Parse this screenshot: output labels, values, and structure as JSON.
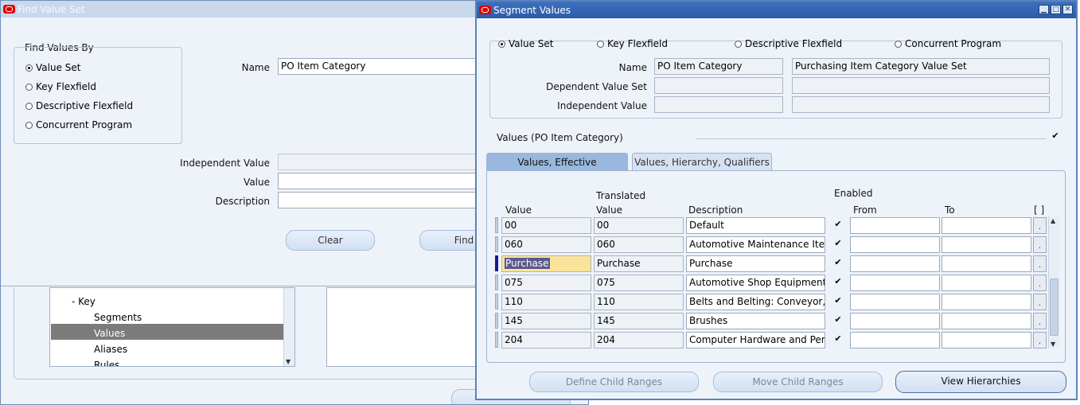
{
  "find_window": {
    "title": "Find Value Set",
    "group_label": "Find Values By",
    "options": [
      "Value Set",
      "Key Flexfield",
      "Descriptive Flexfield",
      "Concurrent Program"
    ],
    "selected_option": "Value Set",
    "name_label": "Name",
    "name_value": "PO Item Category",
    "independent_value_label": "Independent Value",
    "value_label": "Value",
    "description_label": "Description",
    "clear_button": "Clear",
    "find_button": "Find",
    "tree_items": [
      {
        "label": "-  Key",
        "selected": false
      },
      {
        "label": "Segments",
        "selected": false
      },
      {
        "label": "Values",
        "selected": true
      },
      {
        "label": "Aliases",
        "selected": false
      },
      {
        "label": "Rules",
        "selected": false
      }
    ]
  },
  "segment_window": {
    "title": "Segment Values",
    "options": [
      "Value Set",
      "Key Flexfield",
      "Descriptive Flexfield",
      "Concurrent Program"
    ],
    "selected_option": "Value Set",
    "name_label": "Name",
    "name_value": "PO Item Category",
    "name_description": "Purchasing Item Category Value Set",
    "dependent_value_set_label": "Dependent Value Set",
    "independent_value_label": "Independent Value",
    "values_section_label": "Values (PO Item Category)",
    "tabs": [
      "Values, Effective",
      "Values, Hierarchy, Qualifiers"
    ],
    "active_tab": "Values, Effective",
    "columns": {
      "value": "Value",
      "translated_top": "Translated",
      "translated_bottom": "Value",
      "description": "Description",
      "enabled": "Enabled",
      "from": "From",
      "to": "To",
      "flex": "[ ]"
    },
    "rows": [
      {
        "value": "00",
        "translated": "00",
        "description": "Default",
        "enabled": true,
        "current": false
      },
      {
        "value": "060",
        "translated": "060",
        "description": "Automotive Maintenance Item",
        "enabled": true,
        "current": false
      },
      {
        "value": "Purchase",
        "translated": "Purchase",
        "description": "Purchase",
        "enabled": true,
        "current": true
      },
      {
        "value": "075",
        "translated": "075",
        "description": "Automotive Shop Equipment a",
        "enabled": true,
        "current": false
      },
      {
        "value": "110",
        "translated": "110",
        "description": "Belts and Belting: Conveyor, E",
        "enabled": true,
        "current": false
      },
      {
        "value": "145",
        "translated": "145",
        "description": "Brushes",
        "enabled": true,
        "current": false
      },
      {
        "value": "204",
        "translated": "204",
        "description": "Computer Hardware and Perip",
        "enabled": true,
        "current": false
      }
    ],
    "buttons": {
      "define_child_ranges": "Define Child Ranges",
      "move_child_ranges": "Move Child Ranges",
      "view_hierarchies": "View Hierarchies"
    },
    "colors": {
      "title_bar": "#2f62b0",
      "active_tab": "#9ab8de",
      "selected_value_bg": "#fbe49a",
      "selected_text_bg": "#5a5a8a"
    }
  }
}
